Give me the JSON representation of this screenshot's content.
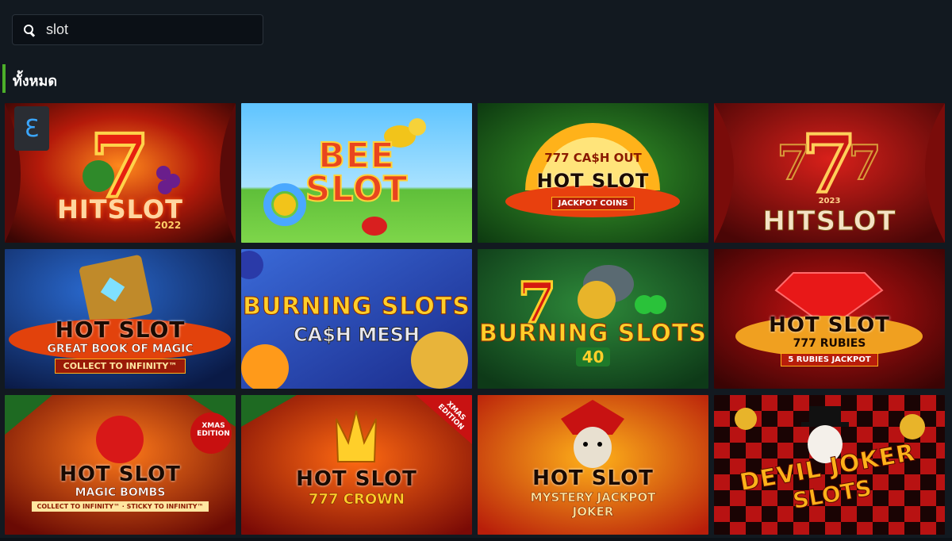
{
  "search": {
    "value": "slot",
    "icon": "search-icon"
  },
  "section": {
    "title": "ทั้งหมด",
    "accent": "#4caf2a"
  },
  "games": [
    {
      "title": "HITSLOT",
      "sub": "2022",
      "extra": "",
      "badge": ""
    },
    {
      "title": "BEE SLOT",
      "sub": "",
      "extra": "",
      "badge": ""
    },
    {
      "title": "HOT SLOT",
      "sub": "777 CA$H OUT",
      "extra": "JACKPOT COINS",
      "badge": ""
    },
    {
      "title": "HITSLOT",
      "sub": "2023",
      "extra": "",
      "badge": ""
    },
    {
      "title": "HOT SLOT",
      "sub": "GREAT BOOK OF MAGIC",
      "extra": "COLLECT TO INFINITY™",
      "badge": ""
    },
    {
      "title": "BURNING Slots",
      "sub": "CA$H MESH",
      "extra": "",
      "badge": ""
    },
    {
      "title": "BURNING Slots",
      "sub": "40",
      "extra": "",
      "badge": ""
    },
    {
      "title": "HOT SLOT",
      "sub": "777 RUBIES",
      "extra": "5 RUBIES JACKPOT",
      "badge": ""
    },
    {
      "title": "HOT SLOT",
      "sub": "MAGIC BOMBS",
      "extra": "COLLECT TO INFINITY™ · STICKY TO INFINITY™",
      "badge": "XMAS EDITION"
    },
    {
      "title": "HOT SLOT",
      "sub": "777 CROWN",
      "extra": "",
      "badge": "XMAS EDITION"
    },
    {
      "title": "HOT SLOT",
      "sub": "MYSTERY JACKPOT",
      "extra": "JOKER",
      "badge": ""
    },
    {
      "title": "DEVIL JOKER",
      "sub": "SLOTS",
      "extra": "",
      "badge": ""
    }
  ]
}
